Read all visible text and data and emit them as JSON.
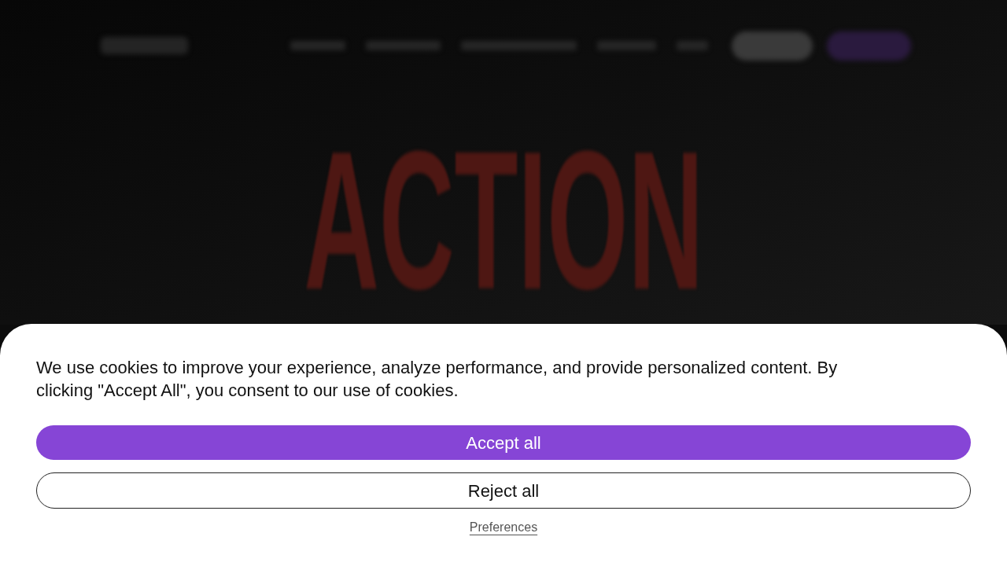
{
  "hero": {
    "heading": "ACTION"
  },
  "cookie_banner": {
    "message": "We use cookies to improve your experience, analyze performance, and provide personalized content. By clicking \"Accept All\", you consent to our use of cookies.",
    "buttons": [
      {
        "label": "Accept all",
        "kind": "primary"
      },
      {
        "label": "Reject all",
        "kind": "secondary"
      }
    ],
    "link": "Preferences"
  }
}
